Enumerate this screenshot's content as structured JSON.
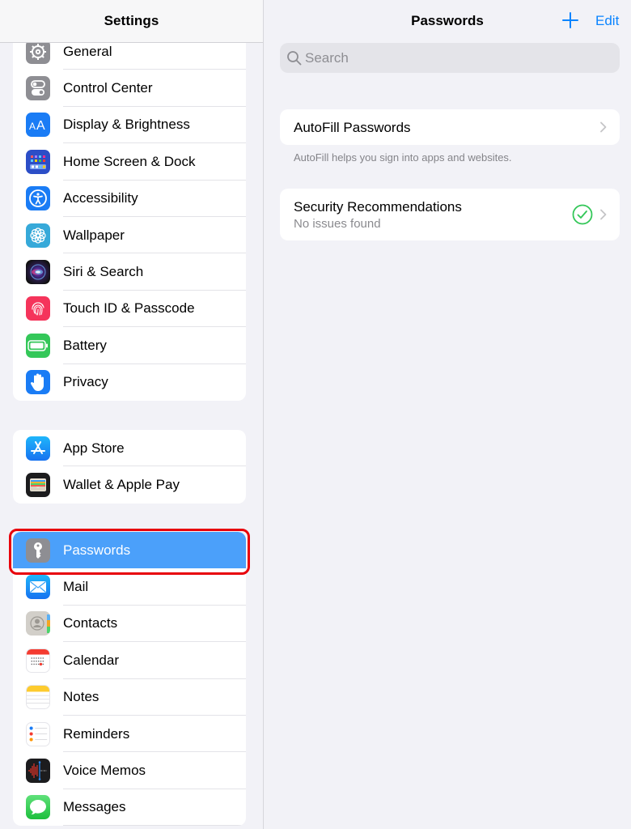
{
  "sidebar": {
    "title": "Settings",
    "groups": [
      {
        "items": [
          {
            "label": "General",
            "icon": "gear-icon",
            "color": "#8e8e93"
          },
          {
            "label": "Control Center",
            "icon": "toggles-icon",
            "color": "#8e8e93"
          },
          {
            "label": "Display & Brightness",
            "icon": "text-size-icon",
            "color": "#1a7cf5"
          },
          {
            "label": "Home Screen & Dock",
            "icon": "app-grid-icon",
            "color": "#2c4ec7"
          },
          {
            "label": "Accessibility",
            "icon": "accessibility-icon",
            "color": "#1a7cf5"
          },
          {
            "label": "Wallpaper",
            "icon": "flower-icon",
            "color": "#36a9d9"
          },
          {
            "label": "Siri & Search",
            "icon": "siri-icon",
            "color": "#1c1c1e"
          },
          {
            "label": "Touch ID & Passcode",
            "icon": "fingerprint-icon",
            "color": "#f5345b"
          },
          {
            "label": "Battery",
            "icon": "battery-icon",
            "color": "#34c759"
          },
          {
            "label": "Privacy",
            "icon": "hand-icon",
            "color": "#1a7cf5"
          }
        ]
      },
      {
        "items": [
          {
            "label": "App Store",
            "icon": "app-store-icon",
            "color": "#1d8ef5"
          },
          {
            "label": "Wallet & Apple Pay",
            "icon": "wallet-icon",
            "color": "#1c1c1e"
          }
        ]
      },
      {
        "items": [
          {
            "label": "Passwords",
            "icon": "key-icon",
            "color": "#8e8e93",
            "selected": true
          },
          {
            "label": "Mail",
            "icon": "envelope-icon",
            "color": "#1d8ef5"
          },
          {
            "label": "Contacts",
            "icon": "contacts-icon",
            "color": "#c9c6c0"
          },
          {
            "label": "Calendar",
            "icon": "calendar-icon",
            "color": "#ffffff"
          },
          {
            "label": "Notes",
            "icon": "notes-icon",
            "color": "#ffffff"
          },
          {
            "label": "Reminders",
            "icon": "reminders-icon",
            "color": "#ffffff"
          },
          {
            "label": "Voice Memos",
            "icon": "waveform-icon",
            "color": "#1c1c1e"
          },
          {
            "label": "Messages",
            "icon": "message-bubble-icon",
            "color": "#34c759"
          }
        ]
      }
    ]
  },
  "detail": {
    "title": "Passwords",
    "add_icon": "plus-icon",
    "edit_label": "Edit",
    "search": {
      "placeholder": "Search",
      "value": ""
    },
    "autofill": {
      "label": "AutoFill Passwords",
      "footnote": "AutoFill helps you sign into apps and websites."
    },
    "security": {
      "label": "Security Recommendations",
      "status": "No issues found",
      "status_icon": "checkmark-circle-icon",
      "status_color": "#34c759"
    }
  },
  "colors": {
    "accent": "#0a84ff",
    "selection": "#4ba0fa",
    "highlight_outline": "#e8000b"
  }
}
